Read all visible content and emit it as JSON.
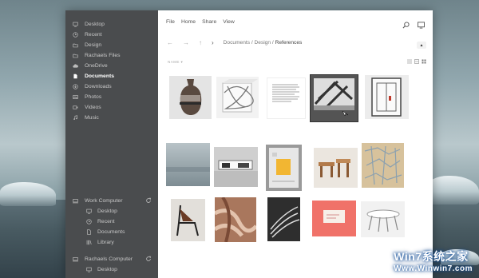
{
  "sidebar": {
    "items": [
      {
        "label": "Desktop",
        "icon": "desktop-icon"
      },
      {
        "label": "Recent",
        "icon": "clock-icon"
      },
      {
        "label": "Design",
        "icon": "folder-icon"
      },
      {
        "label": "Rachaels Files",
        "icon": "folder-icon"
      },
      {
        "label": "OneDrive",
        "icon": "cloud-icon"
      },
      {
        "label": "Documents",
        "icon": "document-icon",
        "active": true
      },
      {
        "label": "Downloads",
        "icon": "download-icon"
      },
      {
        "label": "Photos",
        "icon": "photo-icon"
      },
      {
        "label": "Videos",
        "icon": "video-icon"
      },
      {
        "label": "Music",
        "icon": "music-icon"
      }
    ],
    "computers": [
      {
        "name": "Work Computer",
        "items": [
          "Desktop",
          "Recent",
          "Documents",
          "Library"
        ]
      },
      {
        "name": "Rachaels Computer",
        "items": [
          "Desktop"
        ]
      }
    ]
  },
  "menu": [
    "File",
    "Home",
    "Share",
    "View"
  ],
  "breadcrumb": {
    "parts": [
      "Documents",
      "Design"
    ],
    "current": "References",
    "sep": " / "
  },
  "sort_label": "NAME",
  "watermark": {
    "main": "Win7系统之家",
    "sub": "Www.Winwin7.com"
  },
  "colors": {
    "sidebar": "#4a4c4e",
    "accent_selected": "#545454"
  }
}
